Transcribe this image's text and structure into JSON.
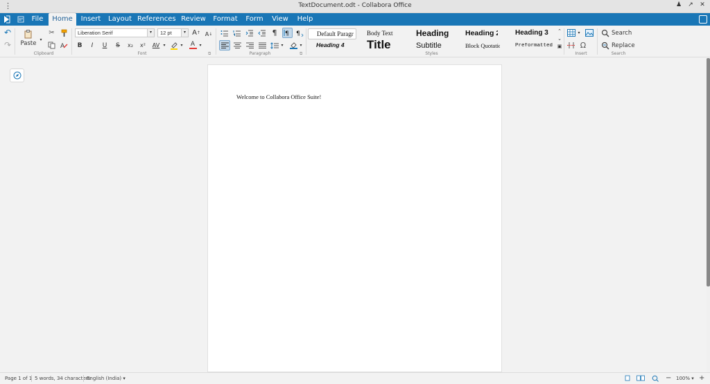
{
  "window": {
    "title": "TextDocument.odt - Collabora Office",
    "kebab_glyph": "⋮",
    "controls": {
      "minimize": "♟",
      "maximize": "↗",
      "close": "✕"
    }
  },
  "menu": {
    "tabs": [
      {
        "label": "File"
      },
      {
        "label": "Home"
      },
      {
        "label": "Insert"
      },
      {
        "label": "Layout"
      },
      {
        "label": "References"
      },
      {
        "label": "Review"
      },
      {
        "label": "Format"
      },
      {
        "label": "Form"
      },
      {
        "label": "View"
      },
      {
        "label": "Help"
      }
    ],
    "active_tab": "Home"
  },
  "toolbar": {
    "clipboard": {
      "paste_label": "Paste",
      "group_label": "Clipboard"
    },
    "font": {
      "font_name": "Liberation Serif",
      "font_size": "12 pt",
      "group_label": "Font",
      "bold": "B",
      "italic": "I",
      "underline": "U",
      "strike": "S",
      "subscript": "x₂",
      "superscript": "x²",
      "char_spacing": "AV",
      "font_color": "A",
      "grow": "A",
      "shrink": "A"
    },
    "paragraph": {
      "group_label": "Paragraph",
      "pilcrow": "¶"
    },
    "styles": {
      "group_label": "Styles",
      "items": [
        {
          "label": "Default Paragr"
        },
        {
          "label": "Body Text"
        },
        {
          "label": "Heading"
        },
        {
          "label": "Heading 2"
        },
        {
          "label": "Heading 3"
        },
        {
          "label": "Heading 4"
        },
        {
          "label": "Title"
        },
        {
          "label": "Subtitle"
        },
        {
          "label": "Block Quotatio"
        },
        {
          "label": "Preformatted"
        }
      ]
    },
    "insert": {
      "group_label": "Insert",
      "omega": "Ω"
    },
    "search": {
      "group_label": "Search",
      "search_label": "Search",
      "replace_label": "Replace"
    }
  },
  "document": {
    "text": "Welcome to Collabora Office Suite!"
  },
  "status": {
    "page": "Page 1 of 1",
    "words": "5 words, 34 characters",
    "language": "English (India)",
    "zoom": "100%",
    "zoom_out": "−",
    "zoom_in": "+"
  },
  "colors": {
    "accent": "#1976b6",
    "background": "#f2f2f2",
    "font_color_bar": "#e53935",
    "highlight_bar": "#ffd600"
  }
}
